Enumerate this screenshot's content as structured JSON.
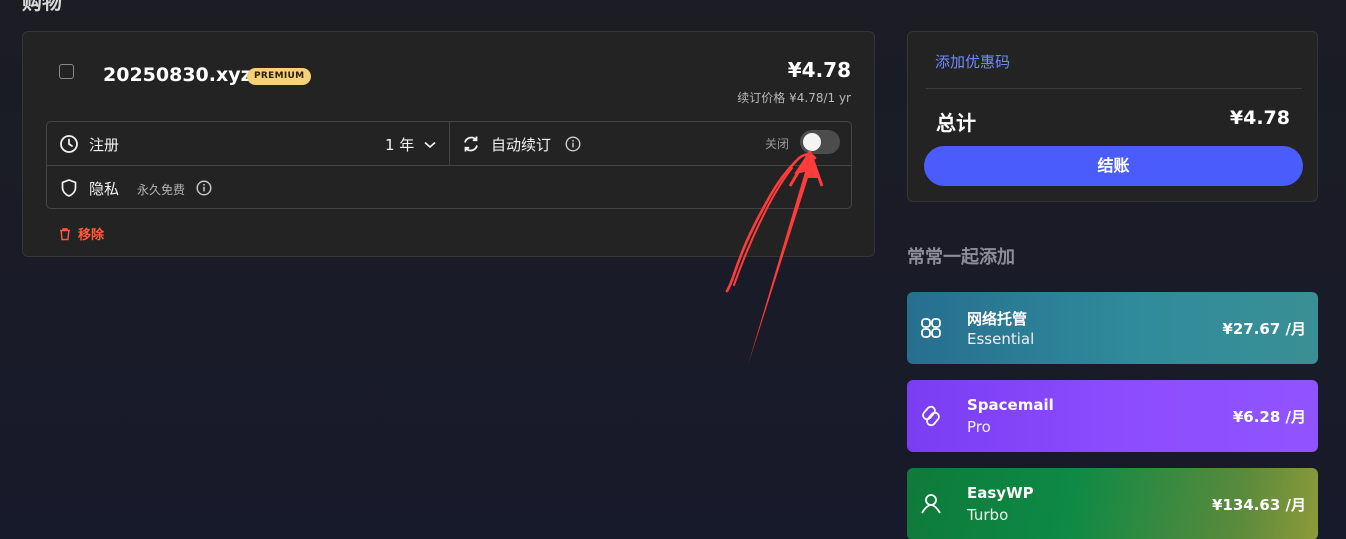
{
  "page": {
    "heading": "购物",
    "colors": {
      "accent": "#4a5cfb",
      "link": "#6b8cff",
      "remove": "#ff5a3c",
      "premium": "#f5d27a",
      "annotation": "#ff3b3b"
    }
  },
  "cart": {
    "domain": "20250830.xyz",
    "badge": "PREMIUM",
    "price": "¥4.78",
    "renew_price": "续订价格 ¥4.78/1 yr",
    "register_label": "注册",
    "term_value": "1 年",
    "auto_renew_label": "自动续订",
    "auto_renew_state_label": "关闭",
    "auto_renew_on": false,
    "privacy_label": "隐私",
    "privacy_note": "永久免费",
    "remove_label": "移除",
    "icons": {
      "register": "clock-icon",
      "auto_renew": "refresh-icon",
      "privacy": "shield-icon",
      "info": "info-icon",
      "term": "chevron-down-icon",
      "remove": "trash-icon"
    }
  },
  "summary": {
    "coupon_link": "添加优惠码",
    "total_label": "总计",
    "total_value": "¥4.78",
    "checkout_label": "结账"
  },
  "often": {
    "title": "常常一起添加",
    "items": [
      {
        "name": "网络托管",
        "tier": "Essential",
        "price": "¥27.67 /月",
        "icon": "hosting-icon"
      },
      {
        "name": "Spacemail",
        "tier": "Pro",
        "price": "¥6.28 /月",
        "icon": "mail-icon"
      },
      {
        "name": "EasyWP",
        "tier": "Turbo",
        "price": "¥134.63 /月",
        "icon": "wordpress-icon"
      }
    ]
  }
}
